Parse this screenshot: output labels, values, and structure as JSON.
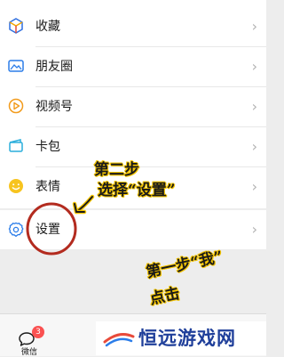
{
  "menu": {
    "items": [
      {
        "label": "收藏",
        "icon": "favorites-cube-icon"
      },
      {
        "label": "朋友圈",
        "icon": "moments-picture-icon"
      },
      {
        "label": "视频号",
        "icon": "channels-play-icon"
      },
      {
        "label": "卡包",
        "icon": "card-wallet-icon"
      },
      {
        "label": "表情",
        "icon": "sticker-smile-icon"
      }
    ],
    "settings": {
      "label": "设置",
      "icon": "gear-icon"
    }
  },
  "tabbar": {
    "chat_label": "微信",
    "chat_badge": "3"
  },
  "annotations": {
    "step2_line1": "第二步",
    "step2_line2": "选择“设置”",
    "step1_line1": "第一步“我”",
    "step1_line2": "点击"
  },
  "watermark": {
    "text": "恒远游戏网"
  },
  "colors": {
    "accent_blue": "#1485ee",
    "settings_circle": "#b32b1f",
    "annotation_outline": "#f3c400"
  }
}
